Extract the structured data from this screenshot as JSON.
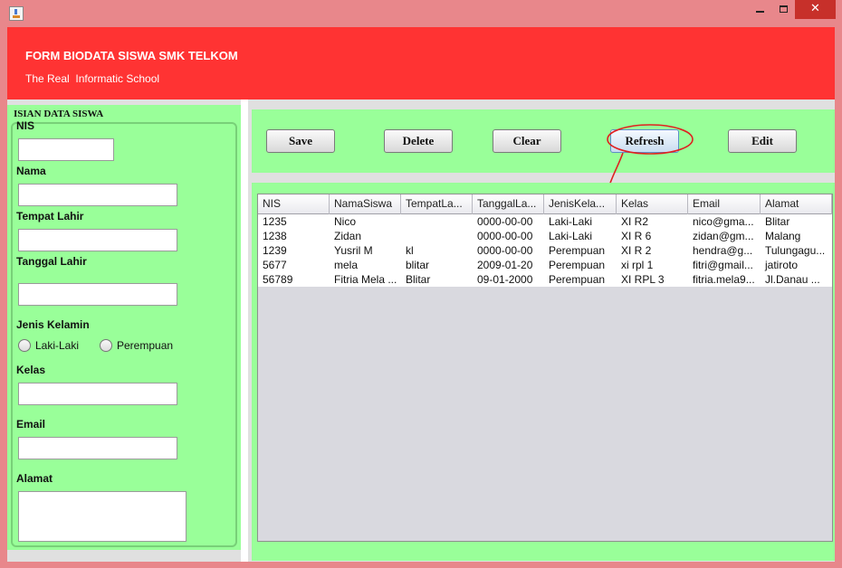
{
  "window": {
    "controls": {
      "close": "✕"
    }
  },
  "header": {
    "title": "FORM BIODATA SISWA SMK TELKOM",
    "subtitle": "The Real  Informatic School"
  },
  "form": {
    "group_title": "ISIAN DATA SISWA",
    "fields": {
      "nis": {
        "label": "NIS",
        "value": ""
      },
      "nama": {
        "label": "Nama",
        "value": ""
      },
      "tempat_lahir": {
        "label": "Tempat Lahir",
        "value": ""
      },
      "tanggal_lahir": {
        "label": "Tanggal Lahir",
        "value": ""
      },
      "jenis_kelamin": {
        "label": "Jenis Kelamin",
        "options": [
          "Laki-Laki",
          "Perempuan"
        ],
        "selected": null
      },
      "kelas": {
        "label": "Kelas",
        "value": ""
      },
      "email": {
        "label": "Email",
        "value": ""
      },
      "alamat": {
        "label": "Alamat",
        "value": ""
      }
    }
  },
  "toolbar": {
    "save": "Save",
    "delete": "Delete",
    "clear": "Clear",
    "refresh": "Refresh",
    "edit": "Edit",
    "annotation_color": "#e02020"
  },
  "table": {
    "columns": [
      "NIS",
      "NamaSiswa",
      "TempatLa...",
      "TanggalLa...",
      "JenisKela...",
      "Kelas",
      "Email",
      "Alamat"
    ],
    "rows": [
      [
        "1235",
        "Nico",
        "",
        "0000-00-00",
        "Laki-Laki",
        "XI R2",
        "nico@gma...",
        "Blitar"
      ],
      [
        "1238",
        "Zidan",
        "",
        "0000-00-00",
        "Laki-Laki",
        "XI R 6",
        "zidan@gm...",
        "Malang"
      ],
      [
        "1239",
        "Yusril M",
        "kl",
        "0000-00-00",
        "Perempuan",
        "XI R 2",
        "hendra@g...",
        "Tulungagu..."
      ],
      [
        "5677",
        "mela",
        "blitar",
        "2009-01-20",
        "Perempuan",
        "xi rpl 1",
        "fitri@gmail...",
        "jatiroto"
      ],
      [
        "56789",
        "Fitria Mela ...",
        "Blitar",
        "09-01-2000",
        "Perempuan",
        "XI RPL 3",
        "fitria.mela9...",
        "Jl.Danau ..."
      ]
    ]
  },
  "colors": {
    "header_bg": "#ff3333",
    "panel_bg": "#99ff99",
    "window_frame": "#e8878b"
  }
}
